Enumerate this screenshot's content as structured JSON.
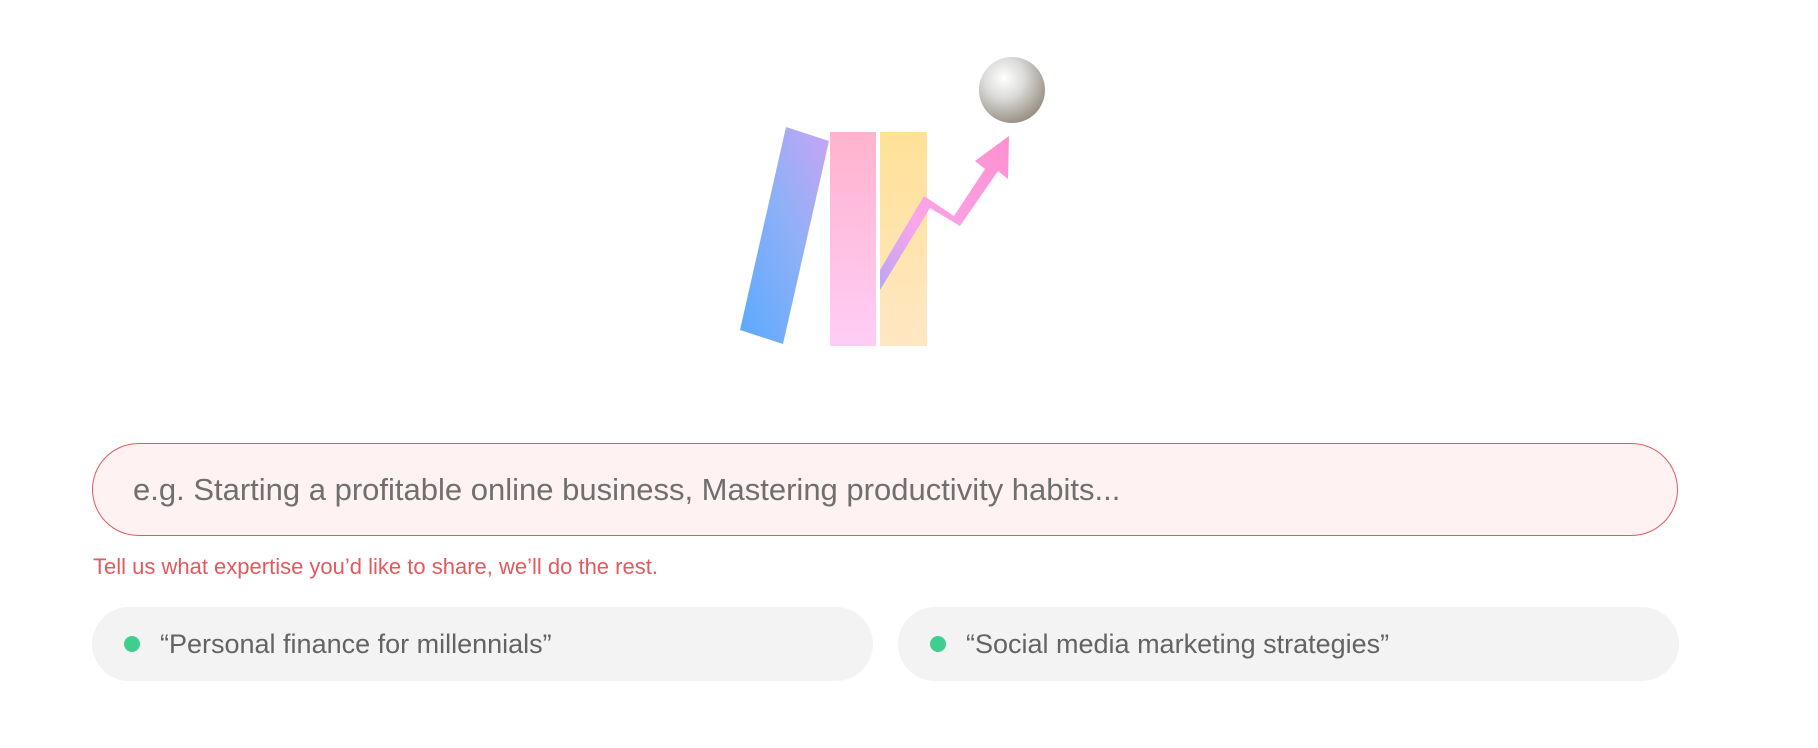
{
  "illustration": {
    "icon": "growth-chart-illustration"
  },
  "topic_input": {
    "placeholder": "e.g. Starting a profitable online business, Mastering productivity habits...",
    "value": ""
  },
  "helper": {
    "text": "Tell us what expertise you’d like to share, we’ll do the rest."
  },
  "suggestions": [
    {
      "label": "“Personal finance for millennials”"
    },
    {
      "label": "“Social media marketing strategies”"
    }
  ],
  "colors": {
    "accent_error": "#e05a5e",
    "input_bg": "#fef2f2",
    "chip_bg": "#f3f3f3",
    "chip_dot": "#3ecf8e"
  }
}
